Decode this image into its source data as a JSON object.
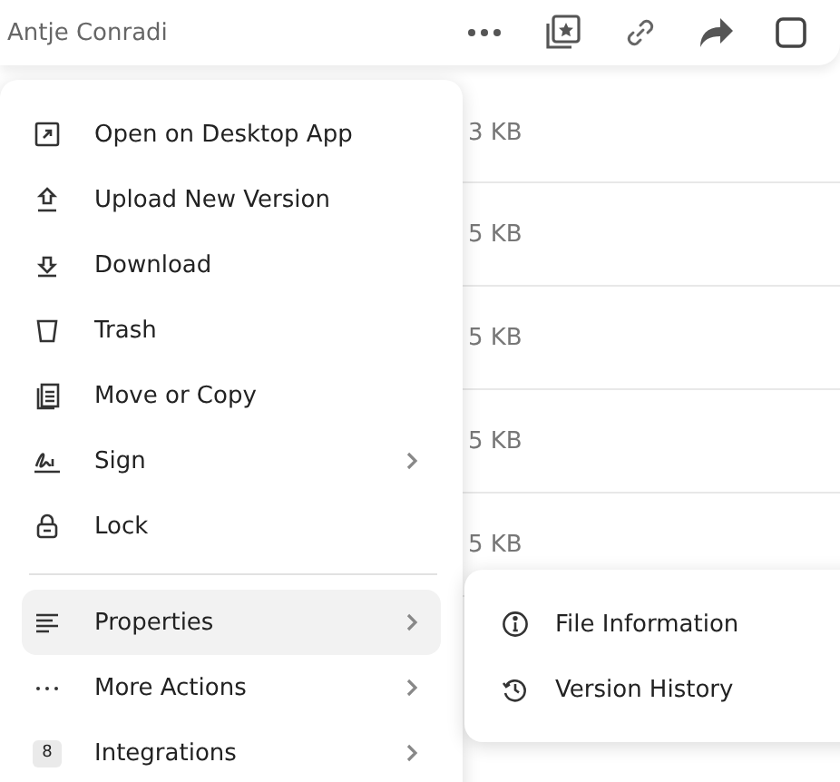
{
  "header": {
    "owner": "Antje Conradi",
    "select_checked": false
  },
  "file_rows": [
    {
      "size": "3 KB"
    },
    {
      "size": "5 KB"
    },
    {
      "size": "5 KB"
    },
    {
      "size": "5 KB"
    },
    {
      "size": "5 KB"
    }
  ],
  "menu": {
    "groups": [
      [
        {
          "label": "Open on Desktop App",
          "submenu": false,
          "selected": false
        },
        {
          "label": "Upload New Version",
          "submenu": false,
          "selected": false
        },
        {
          "label": "Download",
          "submenu": false,
          "selected": false
        },
        {
          "label": "Trash",
          "submenu": false,
          "selected": false
        },
        {
          "label": "Move or Copy",
          "submenu": false,
          "selected": false
        },
        {
          "label": "Sign",
          "submenu": true,
          "selected": false
        },
        {
          "label": "Lock",
          "submenu": false,
          "selected": false
        }
      ],
      [
        {
          "label": "Properties",
          "submenu": true,
          "selected": true
        },
        {
          "label": "More Actions",
          "submenu": true,
          "selected": false
        },
        {
          "label": "Integrations",
          "submenu": true,
          "selected": false,
          "badge": "8"
        }
      ]
    ]
  },
  "submenu": {
    "items": [
      {
        "label": "File Information"
      },
      {
        "label": "Version History"
      }
    ]
  }
}
